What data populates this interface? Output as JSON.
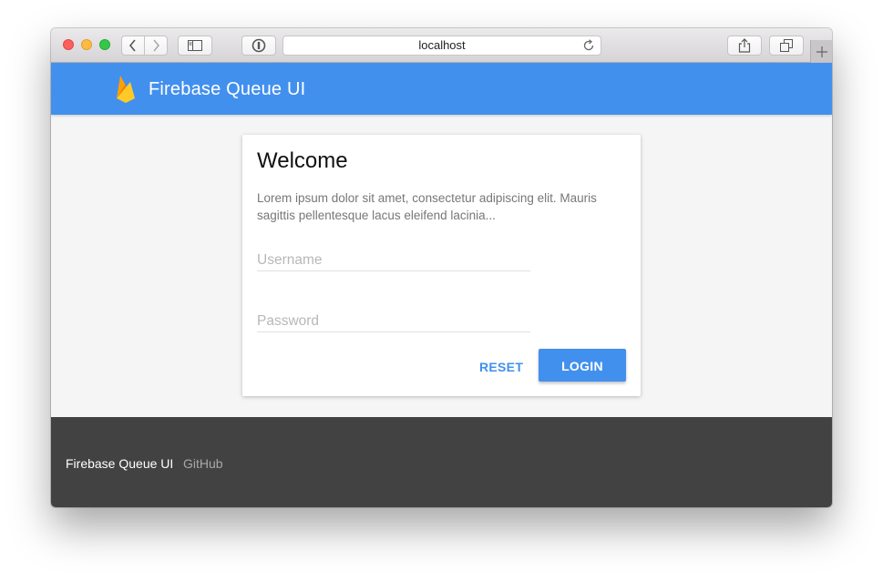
{
  "browser": {
    "address": "localhost"
  },
  "header": {
    "title": "Firebase Queue UI"
  },
  "login": {
    "title": "Welcome",
    "description": "Lorem ipsum dolor sit amet, consectetur adipiscing elit. Mauris sagittis pellentesque lacus eleifend lacinia...",
    "username_value": "",
    "username_placeholder": "Username",
    "password_value": "",
    "password_placeholder": "Password",
    "reset_label": "RESET",
    "login_label": "LOGIN"
  },
  "footer": {
    "brand": "Firebase Queue UI",
    "link_label": "GitHub"
  },
  "colors": {
    "primary": "#4290ee",
    "footer_background": "#424242",
    "page_background": "#f5f5f5"
  },
  "icons": [
    "back-icon",
    "forward-icon",
    "sidebar-icon",
    "privacy-icon",
    "reload-icon",
    "share-icon",
    "tabs-icon",
    "plus-icon",
    "firebase-logo"
  ]
}
